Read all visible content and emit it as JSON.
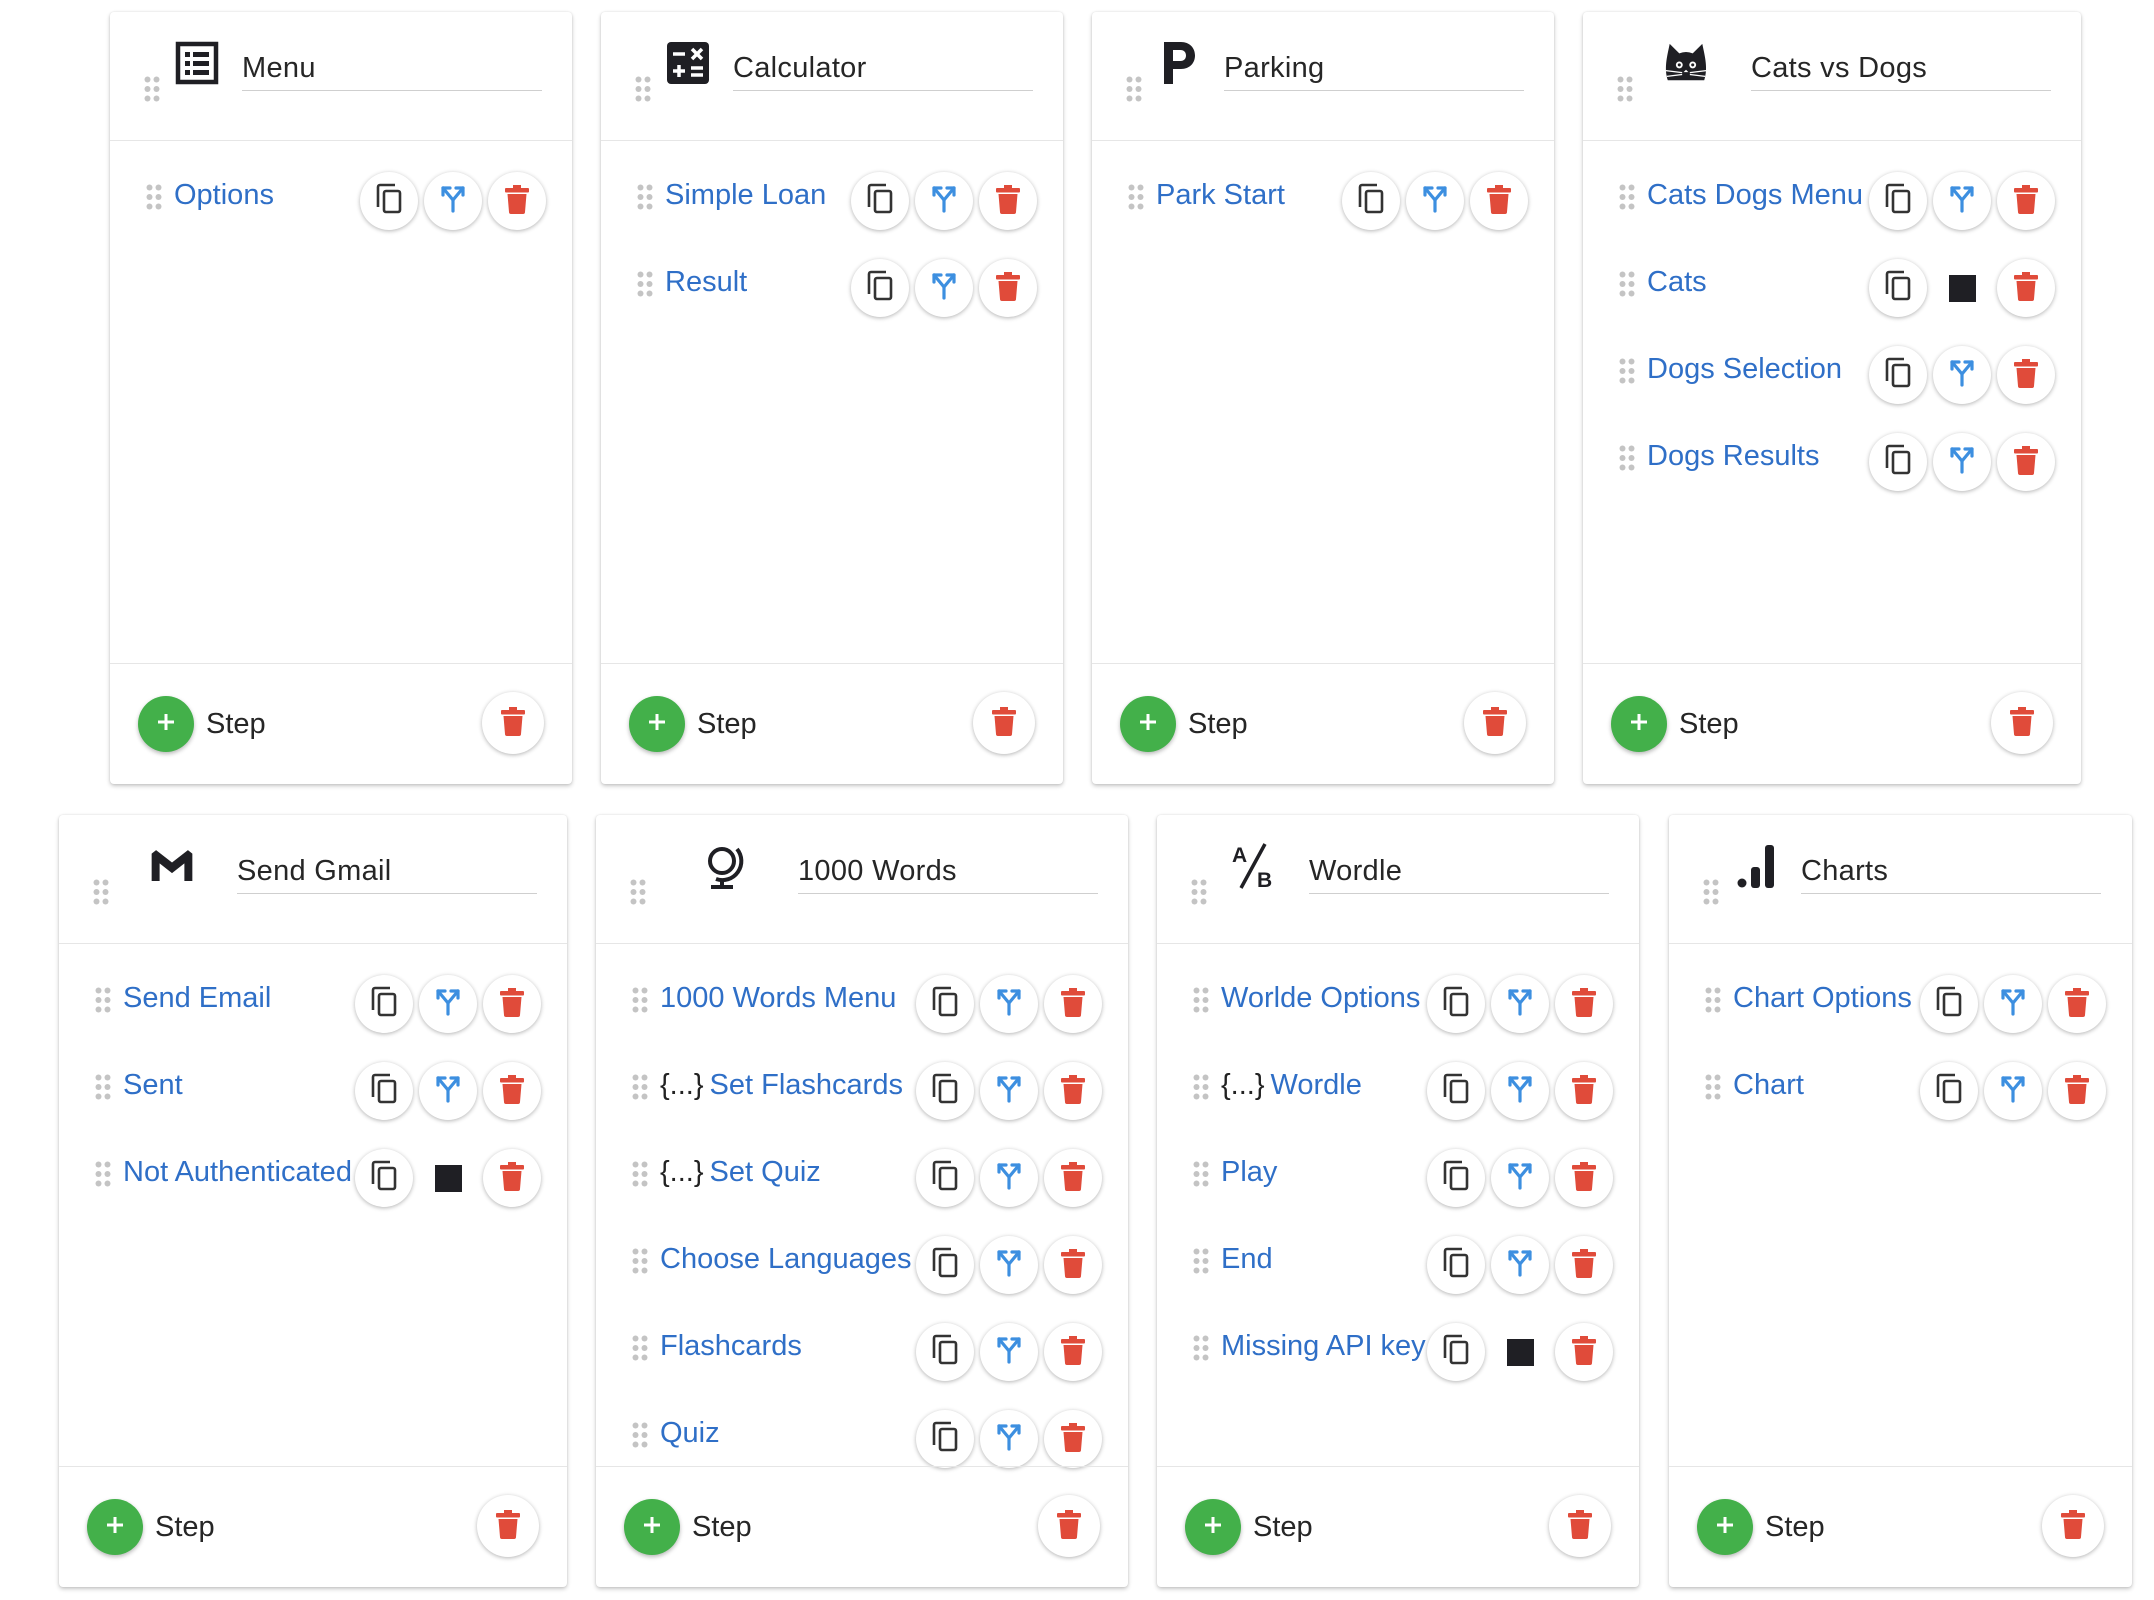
{
  "colors": {
    "link": "#2f6fc7",
    "delete": "#e04b3a",
    "add": "#43b04a",
    "branch": "#3d8fe0"
  },
  "cards": [
    {
      "title": "Menu",
      "icon": "list-icon",
      "steps": [
        {
          "label": "Options",
          "branch": true
        }
      ],
      "footer": {
        "add_label": "Step"
      }
    },
    {
      "title": "Calculator",
      "icon": "calculator-icon",
      "steps": [
        {
          "label": "Simple Loan",
          "branch": true
        },
        {
          "label": "Result",
          "branch": true
        }
      ],
      "footer": {
        "add_label": "Step"
      }
    },
    {
      "title": "Parking",
      "icon": "parking-icon",
      "steps": [
        {
          "label": "Park Start",
          "branch": true
        }
      ],
      "footer": {
        "add_label": "Step"
      }
    },
    {
      "title": "Cats vs Dogs",
      "icon": "cat-icon",
      "steps": [
        {
          "label": "Cats Dogs Menu",
          "branch": true
        },
        {
          "label": "Cats",
          "branch": false
        },
        {
          "label": "Dogs Selection",
          "branch": true
        },
        {
          "label": "Dogs Results",
          "branch": true
        }
      ],
      "footer": {
        "add_label": "Step"
      }
    },
    {
      "title": "Send Gmail",
      "icon": "gmail-icon",
      "steps": [
        {
          "label": "Send Email",
          "branch": true
        },
        {
          "label": "Sent",
          "branch": true
        },
        {
          "label": "Not Authenticated",
          "branch": false
        }
      ],
      "footer": {
        "add_label": "Step"
      }
    },
    {
      "title": "1000 Words",
      "icon": "globe-icon",
      "steps": [
        {
          "label": "1000 Words Menu",
          "branch": true
        },
        {
          "label": "Set Flashcards",
          "branch": true,
          "prefix": "{...}"
        },
        {
          "label": "Set Quiz",
          "branch": true,
          "prefix": "{...}"
        },
        {
          "label": "Choose Languages",
          "branch": true
        },
        {
          "label": "Flashcards",
          "branch": true
        },
        {
          "label": "Quiz",
          "branch": true
        }
      ],
      "footer": {
        "add_label": "Step"
      }
    },
    {
      "title": "Wordle",
      "icon": "ab-test-icon",
      "steps": [
        {
          "label": "Worlde Options",
          "branch": true
        },
        {
          "label": "Wordle",
          "branch": true,
          "prefix": "{...}"
        },
        {
          "label": "Play",
          "branch": true
        },
        {
          "label": "End",
          "branch": true
        },
        {
          "label": "Missing API key",
          "branch": false
        }
      ],
      "footer": {
        "add_label": "Step"
      }
    },
    {
      "title": "Charts",
      "icon": "bar-chart-icon",
      "steps": [
        {
          "label": "Chart Options",
          "branch": true
        },
        {
          "label": "Chart",
          "branch": true
        }
      ],
      "footer": {
        "add_label": "Step"
      }
    }
  ]
}
